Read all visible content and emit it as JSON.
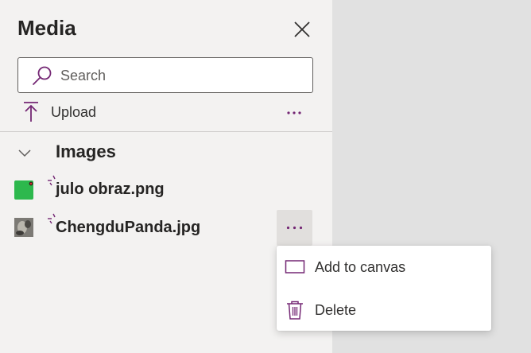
{
  "panel": {
    "title": "Media",
    "close_icon": "close-icon"
  },
  "search": {
    "placeholder": "Search",
    "value": "",
    "icon": "search-icon"
  },
  "toolbar": {
    "upload_label": "Upload",
    "upload_icon": "upload-icon",
    "more_icon": "more-horizontal-icon"
  },
  "section": {
    "title": "Images",
    "expanded": true
  },
  "images": [
    {
      "name": "julo obraz.png",
      "thumb_color": "#2db84d"
    },
    {
      "name": "ChengduPanda.jpg",
      "thumb_color": "#6f6d68"
    }
  ],
  "context_menu": {
    "items": [
      {
        "label": "Add to canvas",
        "icon": "add-to-canvas-icon"
      },
      {
        "label": "Delete",
        "icon": "trash-icon"
      }
    ]
  },
  "colors": {
    "accent": "#742774",
    "panel_bg": "#f3f2f1",
    "canvas_bg": "#e1e1e1"
  }
}
